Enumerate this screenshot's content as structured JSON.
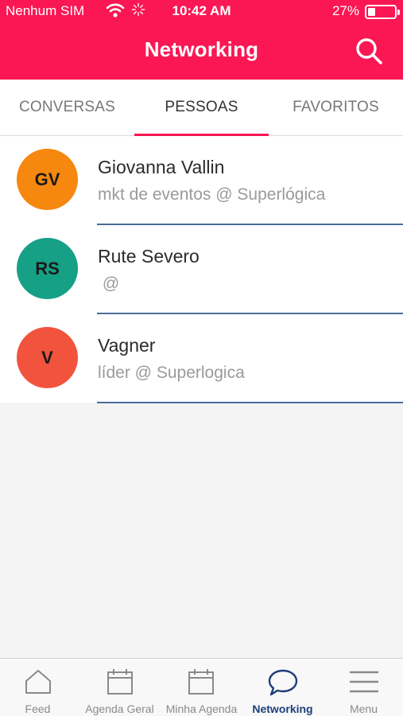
{
  "status_bar": {
    "carrier": "Nenhum SIM",
    "time": "10:42 AM",
    "battery_percent": "27%",
    "battery_level": 0.27
  },
  "header": {
    "title": "Networking",
    "search_icon": "search-icon",
    "color": "#fa1754"
  },
  "tabs": [
    {
      "label": "CONVERSAS",
      "active": false
    },
    {
      "label": "PESSOAS",
      "active": true
    },
    {
      "label": "FAVORITOS",
      "active": false
    }
  ],
  "people": [
    {
      "initials": "GV",
      "name": "Giovanna Vallin",
      "subtitle": "mkt de eventos @ Superlógica",
      "color": "#f6870f"
    },
    {
      "initials": "RS",
      "name": "Rute Severo",
      "subtitle": " @",
      "color": "#16a085"
    },
    {
      "initials": "V",
      "name": "Vagner",
      "subtitle": "líder @ Superlogica",
      "color": "#f2533d"
    }
  ],
  "bottom_nav": [
    {
      "label": "Feed",
      "icon": "home-icon",
      "active": false
    },
    {
      "label": "Agenda Geral",
      "icon": "calendar-icon",
      "active": false
    },
    {
      "label": "Minha Agenda",
      "icon": "calendar-icon",
      "active": false
    },
    {
      "label": "Networking",
      "icon": "chat-bubble-icon",
      "active": true
    },
    {
      "label": "Menu",
      "icon": "menu-icon",
      "active": false
    }
  ],
  "colors": {
    "accent": "#fa1754",
    "nav_active": "#1c3f77",
    "divider": "#4b6c9c"
  }
}
